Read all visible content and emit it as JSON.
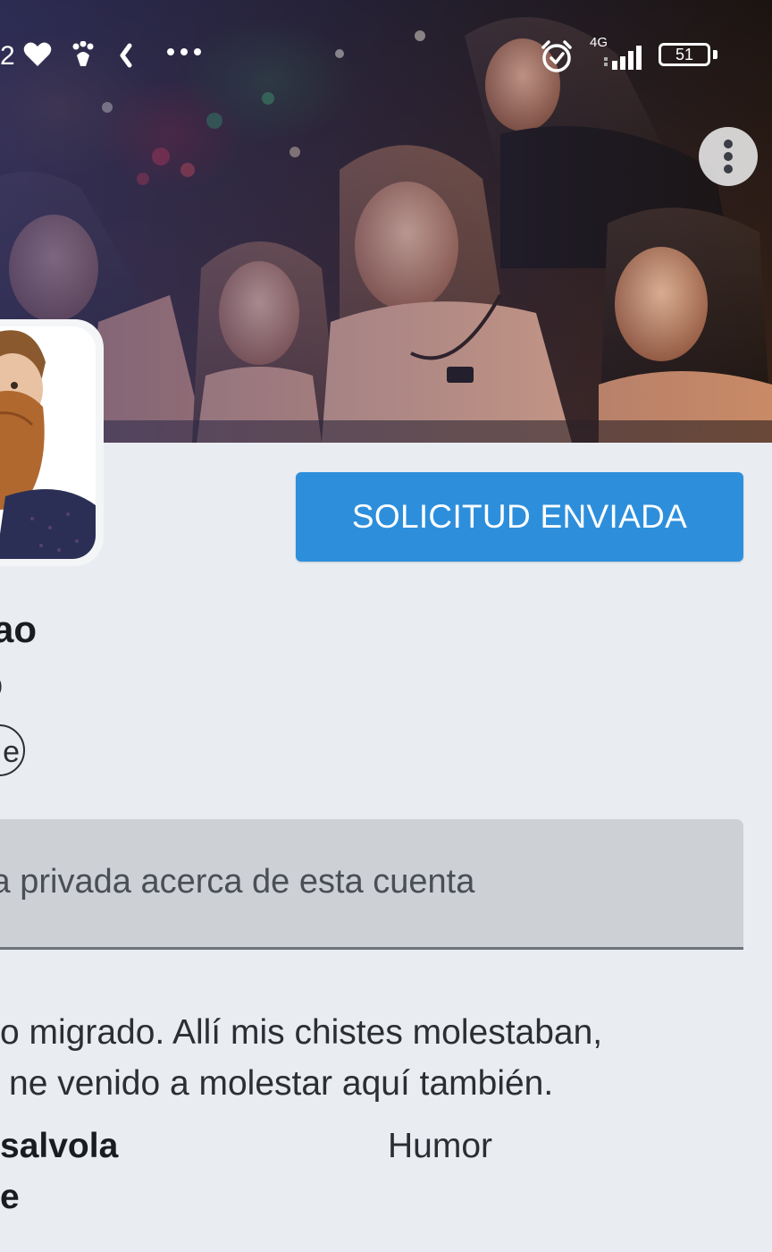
{
  "status_bar": {
    "notification_count": "2",
    "battery_level": "51",
    "network_type": "4G"
  },
  "profile": {
    "display_name": "ao",
    "handle": "o",
    "follow_badge": "e",
    "request_button_label": "SOLICITUD ENVIADA",
    "note_placeholder": "ta privada acerca de esta cuenta",
    "bio": [
      "o migrado. Allí mis chistes molestaban,",
      "ne venido a molestar aquí también."
    ],
    "meta": {
      "line1": "salvola",
      "line2": "e",
      "category": "Humor"
    }
  },
  "colors": {
    "accent": "#2d8fdc",
    "background": "#e9ecf1",
    "note_field": "#cdd0d4"
  },
  "icons": {
    "heart": "heart-icon",
    "paw": "paw-icon",
    "back": "chevron-left-icon",
    "more_status": "more-horizontal-icon",
    "alarm": "alarm-clock-icon",
    "signal": "signal-icon",
    "battery": "battery-icon",
    "more_menu": "more-vertical-icon"
  }
}
